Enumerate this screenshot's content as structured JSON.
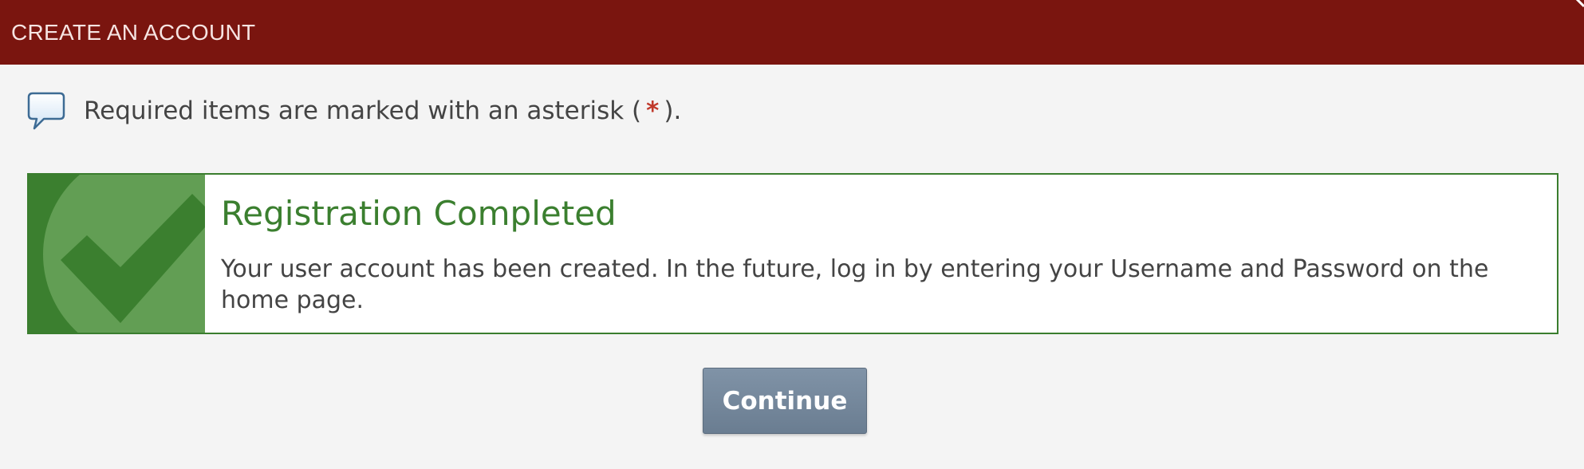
{
  "dialog": {
    "title": "CREATE AN ACCOUNT"
  },
  "required_note": {
    "text_before": "Required items are marked with an asterisk (",
    "asterisk": "*",
    "text_after": ")."
  },
  "success": {
    "title": "Registration Completed",
    "message": "Your user account has been created. In the future, log in by entering your Username and Password on the home page."
  },
  "actions": {
    "continue_label": "Continue"
  },
  "colors": {
    "header": "#7a150f",
    "success_green": "#3b7f2f",
    "button": "#768aa0"
  },
  "icons": {
    "note": "speech-bubble-icon",
    "success": "checkmark-icon",
    "close": "close-icon"
  }
}
